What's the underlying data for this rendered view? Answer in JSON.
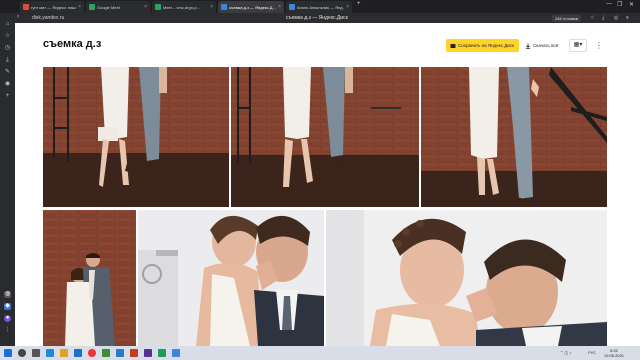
{
  "browser": {
    "tabs": [
      {
        "title": "гугл мит — Яндекс: нашл…",
        "color": "#e04b3a",
        "active": false
      },
      {
        "title": "Google Meet",
        "color": "#2aa463",
        "active": false
      },
      {
        "title": "Meet – vmc-drgn-p…",
        "color": "#2aa463",
        "active": false
      },
      {
        "title": "съемка д.з — Яндекс.Д…",
        "color": "#3b84e0",
        "active": true
      },
      {
        "title": "Анонс Анкальник — Янд…",
        "color": "#3b84e0",
        "active": false
      }
    ],
    "new_tab": "+",
    "close_glyph": "×",
    "url": "disk.yandex.ru",
    "page_title": "съемка д.з — Яндекс.Диск",
    "reviews_button": "24К отзывов",
    "back_glyph": "‹",
    "window_controls": [
      "—",
      "❐",
      "✕"
    ]
  },
  "header": {
    "title": "съемка д.з",
    "save_button": "Сохранить на Яндекс.Диск",
    "download_button": "Скачать всё",
    "view_glyph": "▦▾",
    "more_glyph": "⋮"
  },
  "taskbar": {
    "time": "9:22",
    "date": "19.05.2021",
    "lang": "РУС"
  },
  "colors": {
    "accent_yellow": "#fed42b",
    "browser_dark": "#1f1f22"
  }
}
